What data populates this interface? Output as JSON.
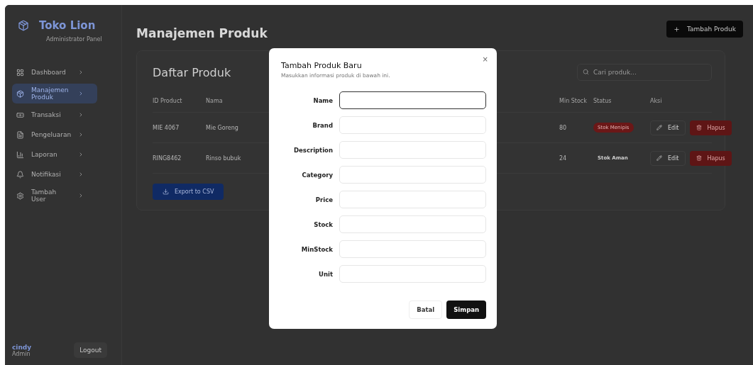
{
  "sidebar": {
    "brand": "Toko Lion",
    "subtitle": "Administrator Panel",
    "items": [
      {
        "label": "Dashboard",
        "selected": false
      },
      {
        "label": "Manajemen Produk",
        "selected": true
      },
      {
        "label": "Transaksi",
        "selected": false
      },
      {
        "label": "Pengeluaran",
        "selected": false
      },
      {
        "label": "Laporan",
        "selected": false
      },
      {
        "label": "Notifikasi",
        "selected": false
      },
      {
        "label": "Tambah User",
        "selected": false
      }
    ],
    "user": {
      "name": "cindy",
      "role": "Admin"
    },
    "logout": "Logout"
  },
  "header": {
    "title": "Manajemen Produk",
    "add_button": "Tambah Produk"
  },
  "card": {
    "title": "Daftar Produk",
    "search": {
      "placeholder": "Cari produk..."
    },
    "columns": [
      "ID Product",
      "Nama",
      "Min Stock",
      "Status",
      "Aksi"
    ],
    "rows": [
      {
        "id": "MIE 4067",
        "name": "Mie Goreng",
        "min_stock": "80",
        "status": "Stok Menipis",
        "kind": "critical",
        "edit": "Edit",
        "delete": "Hapus"
      },
      {
        "id": "RING8462",
        "name": "Rinso bubuk",
        "min_stock": "24",
        "status": "Stok Aman",
        "kind": "safe",
        "edit": "Edit",
        "delete": "Hapus"
      }
    ],
    "export_button": "Export to CSV"
  },
  "dialog": {
    "title": "Tambah Produk Baru",
    "subtitle": "Masukkan informasi produk di bawah ini.",
    "close": "×",
    "fields": [
      {
        "label": "Name",
        "focused": true
      },
      {
        "label": "Brand",
        "focused": false
      },
      {
        "label": "Description",
        "focused": false
      },
      {
        "label": "Category",
        "focused": false
      },
      {
        "label": "Price",
        "focused": false
      },
      {
        "label": "Stock",
        "focused": false
      },
      {
        "label": "MinStock",
        "focused": false
      },
      {
        "label": "Unit",
        "focused": false
      }
    ],
    "cancel": "Batal",
    "save": "Simpan"
  }
}
